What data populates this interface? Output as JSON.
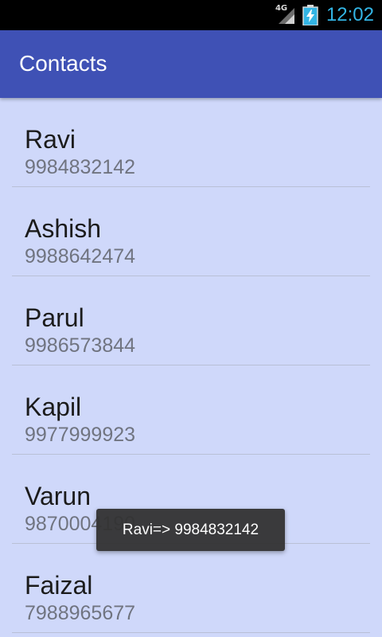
{
  "status_bar": {
    "network_label": "4G",
    "clock": "12:02",
    "clock_color": "#33b5e5",
    "icons": [
      "signal-icon",
      "battery-charging-icon"
    ]
  },
  "app_bar": {
    "title": "Contacts",
    "color": "#3f51b5"
  },
  "contacts": [
    {
      "name": "Ravi",
      "phone": "9984832142"
    },
    {
      "name": "Ashish",
      "phone": "9988642474"
    },
    {
      "name": "Parul",
      "phone": "9986573844"
    },
    {
      "name": "Kapil",
      "phone": "9977999923"
    },
    {
      "name": "Varun",
      "phone": "9870004190"
    },
    {
      "name": "Faizal",
      "phone": "7988965677"
    }
  ],
  "toast": {
    "text": "Ravi=> 9984832142"
  },
  "colors": {
    "list_background": "#cfd8fa",
    "name_text": "#1b1b1b",
    "phone_text": "#707480"
  }
}
